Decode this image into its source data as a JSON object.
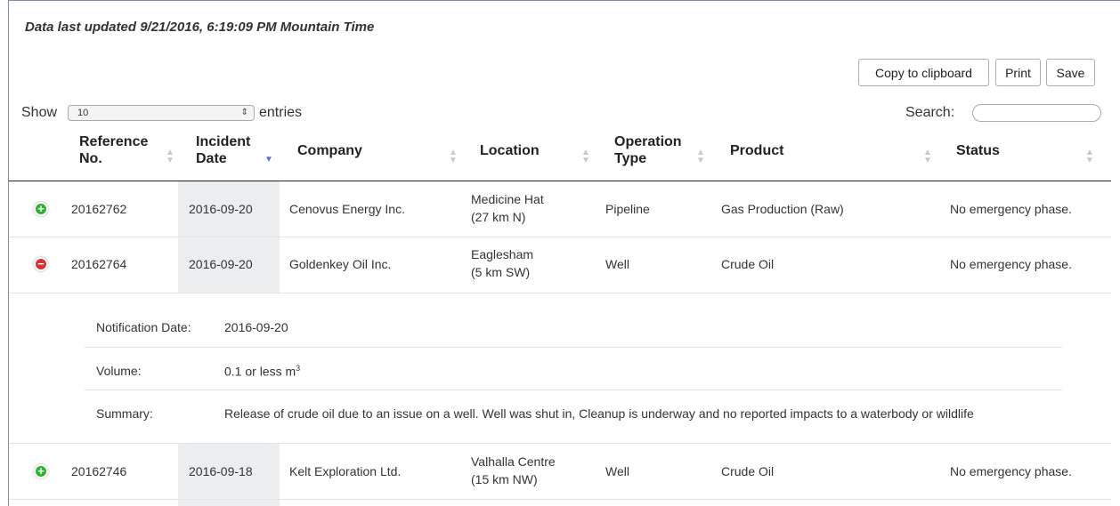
{
  "last_updated": "Data last updated 9/21/2016, 6:19:09 PM Mountain Time",
  "toolbar": {
    "copy_label": "Copy to clipboard",
    "print_label": "Print",
    "save_label": "Save"
  },
  "length": {
    "show_label": "Show",
    "value": "10",
    "entries_label": "entries"
  },
  "search": {
    "label": "Search:",
    "value": ""
  },
  "columns": {
    "ref_line1": "Reference",
    "ref_line2": "No.",
    "date_line1": "Incident",
    "date_line2": "Date",
    "company": "Company",
    "location": "Location",
    "optype_line1": "Operation",
    "optype_line2": "Type",
    "product": "Product",
    "status": "Status"
  },
  "rows": [
    {
      "toggle": "plus",
      "ref": "20162762",
      "date": "2016-09-20",
      "company": "Cenovus Energy Inc.",
      "location_line1": "Medicine Hat",
      "location_line2": "(27 km N)",
      "optype": "Pipeline",
      "product": "Gas Production (Raw)",
      "status": "No emergency phase."
    },
    {
      "toggle": "minus",
      "ref": "20162764",
      "date": "2016-09-20",
      "company": "Goldenkey Oil Inc.",
      "location_line1": "Eaglesham",
      "location_line2": "(5 km SW)",
      "optype": "Well",
      "product": "Crude Oil",
      "status": "No emergency phase."
    },
    {
      "toggle": "plus",
      "ref": "20162746",
      "date": "2016-09-18",
      "company": "Kelt Exploration Ltd.",
      "location_line1": "Valhalla Centre",
      "location_line2": "(15 km NW)",
      "optype": "Well",
      "product": "Crude Oil",
      "status": "No emergency phase."
    }
  ],
  "details": {
    "notification_label": "Notification Date:",
    "notification_value": "2016-09-20",
    "volume_label": "Volume:",
    "volume_value": "0.1 or less m",
    "volume_unit_exp": "3",
    "summary_label": "Summary:",
    "summary_value": "Release of crude oil due to an issue on a well. Well was shut in, Cleanup is underway and no reported impacts to a waterbody or wildlife"
  },
  "colors": {
    "plus": "#31b131",
    "minus": "#d33333",
    "sort_active": "#5d74b8"
  },
  "icons": {
    "expand": "plus-circle-icon",
    "collapse": "minus-circle-icon",
    "sort": "sort-both-icon",
    "sort_desc": "sort-desc-icon"
  }
}
